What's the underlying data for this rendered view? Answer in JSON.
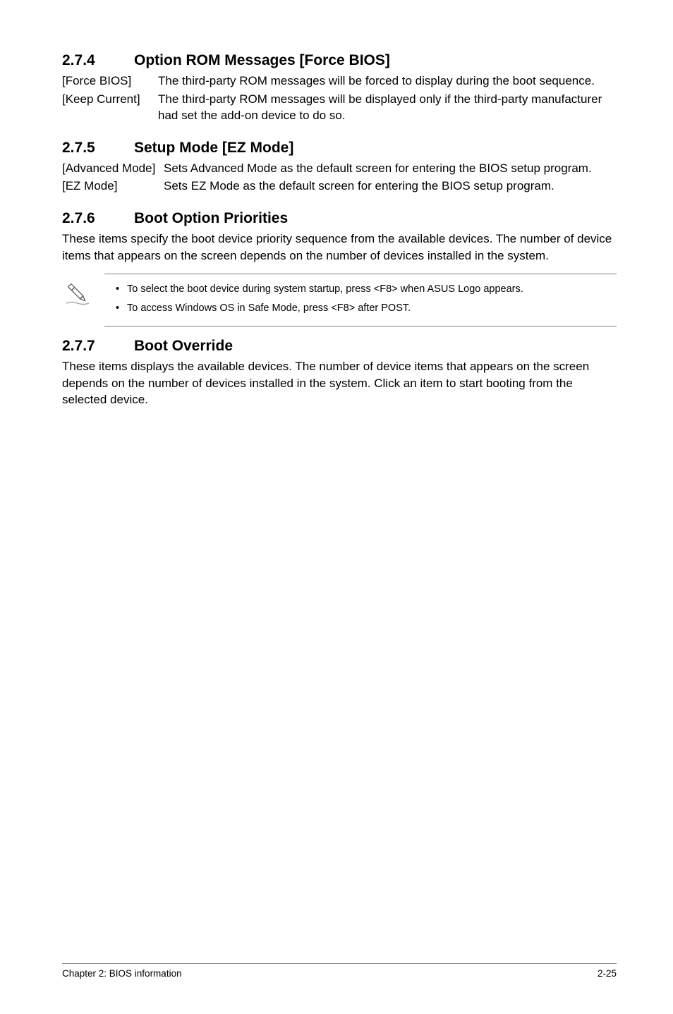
{
  "sections": {
    "s274": {
      "num": "2.7.4",
      "title": "Option ROM Messages [Force BIOS]",
      "rows": [
        {
          "term": "[Force BIOS]",
          "desc": "The third-party ROM messages will be forced to display during the boot sequence."
        },
        {
          "term": "[Keep Current]",
          "desc": "The third-party ROM messages will be displayed only if the third-party manufacturer had set the add-on device to do so."
        }
      ]
    },
    "s275": {
      "num": "2.7.5",
      "title": "Setup Mode [EZ Mode]",
      "rows": [
        {
          "term": "[Advanced Mode]",
          "desc": "Sets Advanced Mode as the default screen for entering the BIOS setup program."
        },
        {
          "term": "[EZ Mode]",
          "desc": "Sets EZ Mode as the default screen for entering the BIOS setup program."
        }
      ]
    },
    "s276": {
      "num": "2.7.6",
      "title": "Boot Option Priorities",
      "body": "These items specify the boot device priority sequence from the available devices. The number of device items that appears on the screen depends on the number of devices installed in the system.",
      "notes": [
        "To select the boot device during system startup, press <F8> when ASUS Logo appears.",
        "To access Windows OS in Safe Mode, press <F8> after POST."
      ]
    },
    "s277": {
      "num": "2.7.7",
      "title": "Boot Override",
      "body": "These items displays the available devices. The number of device items that appears on the screen depends on the number of devices installed in the system. Click an item to start booting from the selected device."
    }
  },
  "footer": {
    "left": "Chapter 2: BIOS information",
    "right": "2-25"
  }
}
